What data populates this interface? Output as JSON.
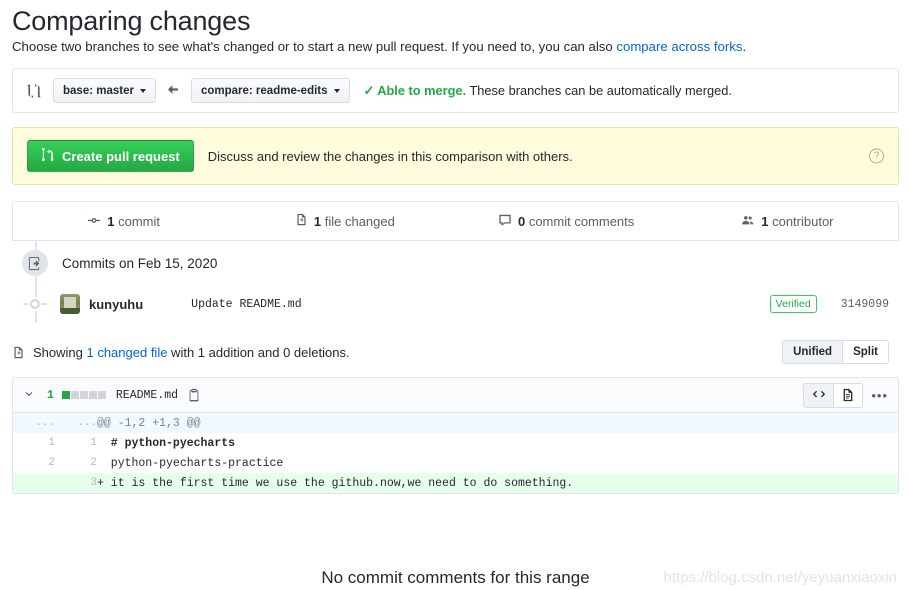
{
  "header": {
    "title": "Comparing changes",
    "subtitle_before": "Choose two branches to see what's changed or to start a new pull request. If you need to, you can also ",
    "subtitle_link": "compare across forks",
    "subtitle_after": "."
  },
  "compare_bar": {
    "compare_icon": "git-compare-icon",
    "base_label": "base: master",
    "arrow_icon": "arrow-left-icon",
    "compare_label": "compare: readme-edits",
    "check_icon": "check-icon",
    "merge_status": "Able to merge.",
    "merge_detail": " These branches can be automatically merged."
  },
  "pr_banner": {
    "button_icon": "git-pull-request-icon",
    "button_label": "Create pull request",
    "text": "Discuss and review the changes in this comparison with others.",
    "help_icon": "question-icon",
    "help_glyph": "?",
    "background": "#fffbdd"
  },
  "stats": [
    {
      "icon": "commit-icon",
      "count": "1",
      "label": "commit"
    },
    {
      "icon": "file-diff-icon",
      "count": "1",
      "label": "file changed"
    },
    {
      "icon": "comment-icon",
      "count": "0",
      "label": "commit comments"
    },
    {
      "icon": "people-icon",
      "count": "1",
      "label": "contributor"
    }
  ],
  "commits": {
    "group_icon": "repo-push-icon",
    "group_label": "Commits on Feb 15, 2020",
    "rows": [
      {
        "avatar": "user-avatar",
        "author": "kunyuhu",
        "message": "Update README.md",
        "verified": "Verified",
        "sha": "3149099"
      }
    ]
  },
  "showing": {
    "icon": "file-diff-icon",
    "text_before": "Showing ",
    "link": "1 changed file",
    "text_mid": " with ",
    "additions": "1 addition",
    "text_and": " and ",
    "deletions": "0 deletions",
    "text_end": ".",
    "unified_label": "Unified",
    "split_label": "Split",
    "selected_view": "Unified"
  },
  "diff_file": {
    "chevron_icon": "chevron-down-icon",
    "change_count": "1",
    "diffstat_blocks": [
      "add",
      "none",
      "none",
      "none",
      "none"
    ],
    "filename": "README.md",
    "copy_icon": "copy-path-icon",
    "code_view_icon": "code-icon",
    "rendered_view_icon": "file-icon",
    "kebab_icon": "kebab-horizontal-icon",
    "kebab_glyph": "•••",
    "selected_action": "code",
    "rows": [
      {
        "type": "hunk",
        "old": "...",
        "new": "...",
        "code": "@@ -1,2 +1,3 @@"
      },
      {
        "type": "context",
        "old": "1",
        "new": "1",
        "code": "  # python-pyecharts",
        "markdown_heading": true
      },
      {
        "type": "context",
        "old": "2",
        "new": "2",
        "code": "  python-pyecharts-practice"
      },
      {
        "type": "add",
        "old": "",
        "new": "3",
        "code": "+ it is the first time we use the github.now,we need to do something."
      }
    ]
  },
  "footer": {
    "no_comments": "No commit comments for this range",
    "watermark": "https://blog.csdn.net/yeyuanxiaoxin"
  },
  "colors": {
    "accent_blue": "#0366d6",
    "green": "#28a745",
    "banner_yellow": "#fffbdd",
    "add_row": "#e6ffed",
    "hunk_row": "#f1f8ff",
    "border": "#e1e4e8"
  }
}
